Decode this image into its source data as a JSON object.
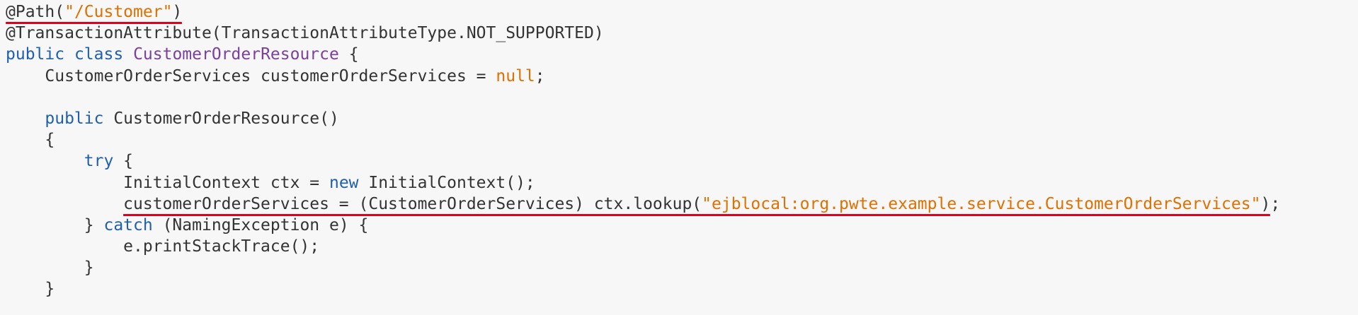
{
  "theme": {
    "background": "#f7f7f7",
    "colors": {
      "plain": "#333333",
      "keyword": "#1f5fb0",
      "string": "#e07000",
      "classname": "#7b3fa0",
      "underline": "#e0001b"
    }
  },
  "code_lines": [
    {
      "indent": 0,
      "underlined": true,
      "tokens": [
        {
          "t": "@Path(",
          "k": "plain"
        },
        {
          "t": "\"/Customer\"",
          "k": "string"
        },
        {
          "t": ")",
          "k": "plain"
        }
      ]
    },
    {
      "indent": 0,
      "tokens": [
        {
          "t": "@TransactionAttribute(TransactionAttributeType.NOT_SUPPORTED)",
          "k": "plain"
        }
      ]
    },
    {
      "indent": 0,
      "tokens": [
        {
          "t": "public",
          "k": "keyword"
        },
        {
          "t": " ",
          "k": "plain"
        },
        {
          "t": "class",
          "k": "keyword"
        },
        {
          "t": " ",
          "k": "plain"
        },
        {
          "t": "CustomerOrderResource",
          "k": "classname"
        },
        {
          "t": " {",
          "k": "plain"
        }
      ]
    },
    {
      "indent": 4,
      "tokens": [
        {
          "t": "CustomerOrderServices customerOrderServices = ",
          "k": "plain"
        },
        {
          "t": "null",
          "k": "string"
        },
        {
          "t": ";",
          "k": "plain"
        }
      ]
    },
    {
      "indent": 0,
      "tokens": []
    },
    {
      "indent": 4,
      "tokens": [
        {
          "t": "public",
          "k": "keyword"
        },
        {
          "t": " CustomerOrderResource()",
          "k": "plain"
        }
      ]
    },
    {
      "indent": 4,
      "tokens": [
        {
          "t": "{",
          "k": "plain"
        }
      ]
    },
    {
      "indent": 8,
      "tokens": [
        {
          "t": "try",
          "k": "keyword"
        },
        {
          "t": " {",
          "k": "plain"
        }
      ]
    },
    {
      "indent": 12,
      "tokens": [
        {
          "t": "InitialContext ctx = ",
          "k": "plain"
        },
        {
          "t": "new",
          "k": "keyword"
        },
        {
          "t": " InitialContext();",
          "k": "plain"
        }
      ]
    },
    {
      "indent": 12,
      "underlined": true,
      "trailing": ";",
      "tokens": [
        {
          "t": "customerOrderServices = (CustomerOrderServices) ctx.lookup(",
          "k": "plain"
        },
        {
          "t": "\"ejblocal:org.pwte.example.service.CustomerOrderServices\"",
          "k": "string"
        },
        {
          "t": ")",
          "k": "plain"
        }
      ]
    },
    {
      "indent": 8,
      "tokens": [
        {
          "t": "} ",
          "k": "plain"
        },
        {
          "t": "catch",
          "k": "keyword"
        },
        {
          "t": " (NamingException e) {",
          "k": "plain"
        }
      ]
    },
    {
      "indent": 12,
      "tokens": [
        {
          "t": "e.printStackTrace();",
          "k": "plain"
        }
      ]
    },
    {
      "indent": 8,
      "tokens": [
        {
          "t": "}",
          "k": "plain"
        }
      ]
    },
    {
      "indent": 4,
      "tokens": [
        {
          "t": "}",
          "k": "plain"
        }
      ]
    }
  ]
}
